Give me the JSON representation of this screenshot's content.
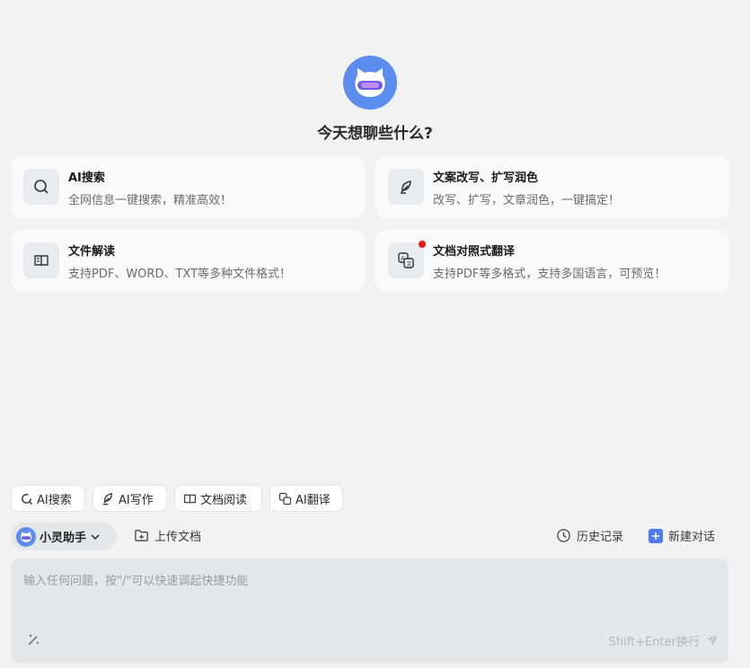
{
  "header": {
    "title": "今天想聊些什么?",
    "logo_icon": "mascot-logo"
  },
  "cards": [
    {
      "title": "AI搜索",
      "desc": "全网信息一键搜索，精准高效！",
      "icon": "search-icon"
    },
    {
      "title": "文案改写、扩写润色",
      "desc": "改写、扩写，文章润色，一键搞定！",
      "icon": "feather-icon"
    },
    {
      "title": "文件解读",
      "desc": "支持PDF、WORD、TXT等多种文件格式！",
      "icon": "book-icon"
    },
    {
      "title": "文档对照式翻译",
      "desc": "支持PDF等多格式，支持多国语言，可预览！",
      "icon": "translate-icon"
    }
  ],
  "chips": [
    {
      "label": "AI搜索",
      "icon": "search-refresh-icon"
    },
    {
      "label": "AI写作",
      "icon": "pen-icon"
    },
    {
      "label": "文档阅读",
      "icon": "book-icon"
    },
    {
      "label": "AI翻译",
      "icon": "translate-icon"
    }
  ],
  "toolbar": {
    "assistant_label": "小灵助手",
    "upload_label": "上传文档",
    "history_label": "历史记录",
    "new_chat_label": "新建对话"
  },
  "input": {
    "placeholder": "输入任何问题，按\"/\"可以快速调起快捷功能",
    "value": "",
    "hint": "Shift+Enter换行"
  },
  "colors": {
    "background": "#f2f2f2",
    "brand": "#5b8dee",
    "new_chat_icon": "#4e7cf0",
    "badge": "#e11b1b"
  }
}
